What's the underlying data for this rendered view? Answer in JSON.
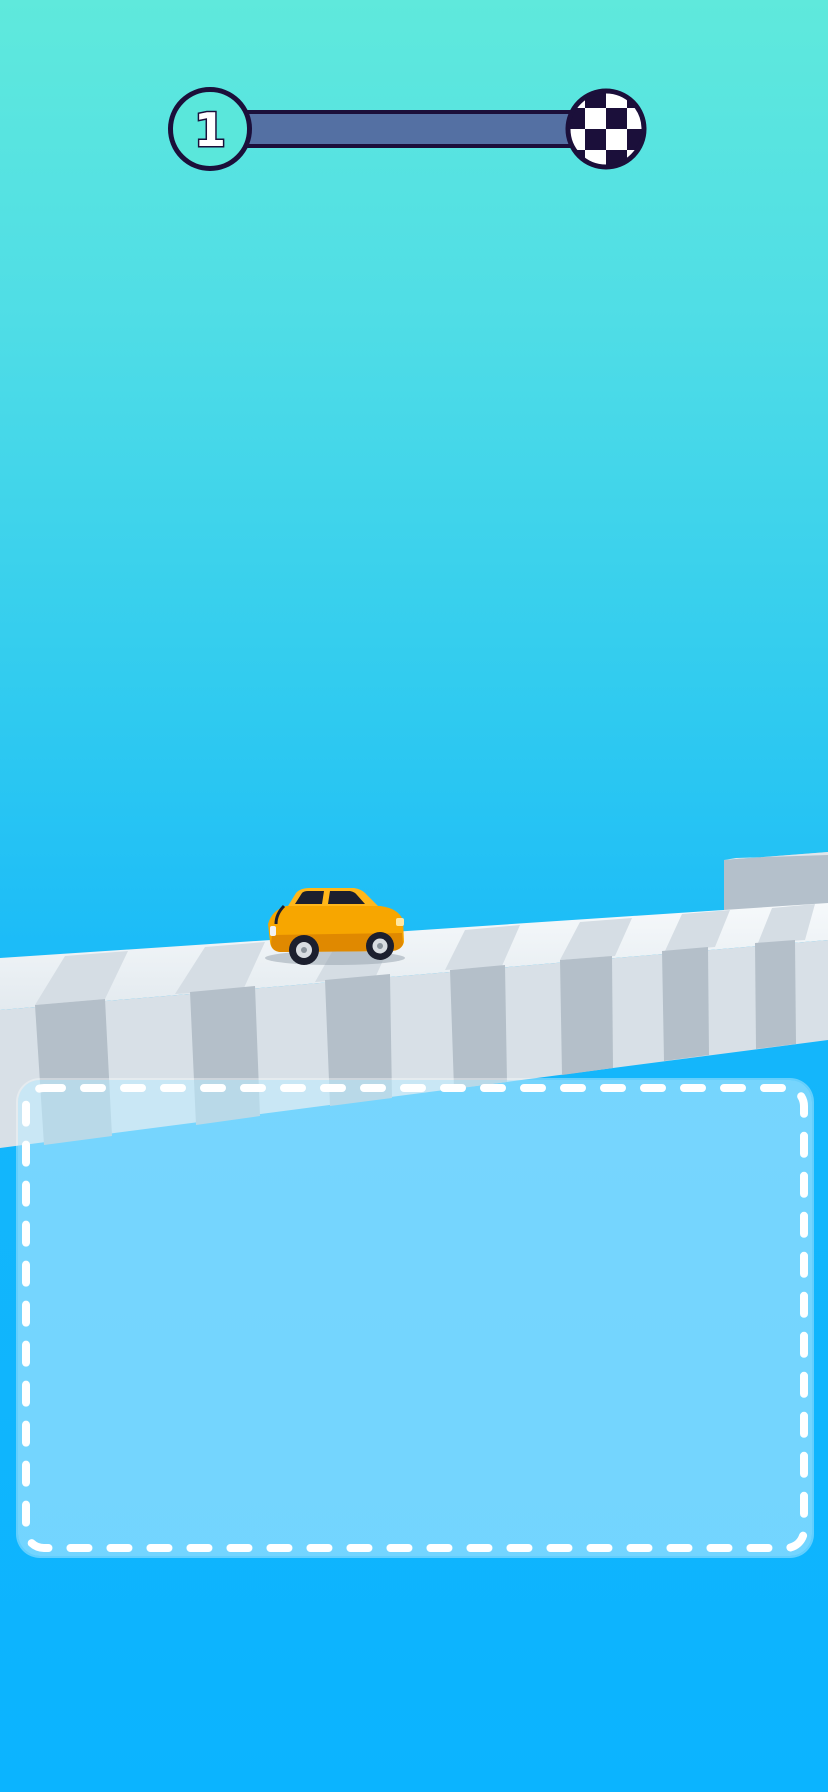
{
  "hud": {
    "level": "1",
    "progress": 0
  },
  "icons": {
    "finish": "checkered-flag-icon",
    "vehicle": "yellow-car"
  },
  "colors": {
    "sky_top": "#5fe9dc",
    "sky_bottom": "#0bb4ff",
    "progress_track": "#5470a3",
    "progress_fill": "#5ae7db",
    "outline": "#1b0f3a",
    "car": "#f7a600",
    "drawing_area": "#bfecff"
  }
}
